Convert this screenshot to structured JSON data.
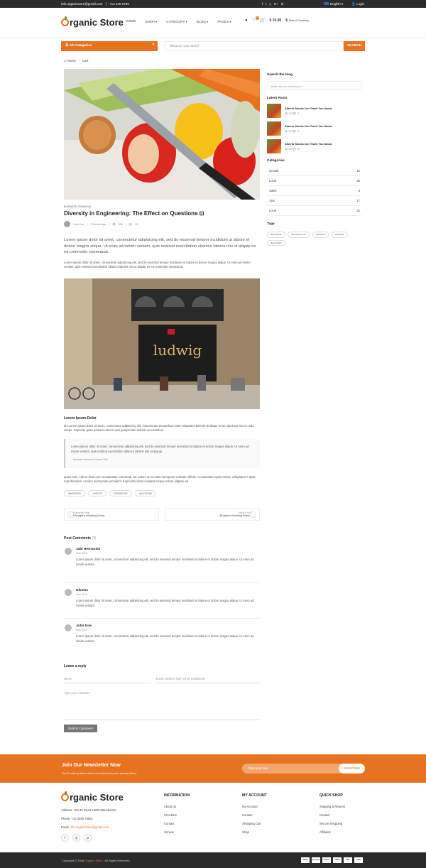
{
  "topbar": {
    "email": "info.organicstore@gmail.com",
    "sep": "|",
    "phone": "+12 345 6789",
    "social": [
      "f",
      "t",
      "y",
      "G+",
      "in"
    ],
    "language": "English ▾",
    "login": "Login"
  },
  "logo": {
    "rest": "rganic Store"
  },
  "nav": [
    "HOME",
    "SHOP",
    "CATEGORY",
    "BLOG",
    "PAGES"
  ],
  "cart": {
    "amount": "$ 15.00",
    "currency": "Select Currency",
    "badge": "2"
  },
  "catbar": {
    "label": "☰  All Categories",
    "arrow": "▾"
  },
  "search": {
    "placeholder": "What do you need?",
    "button": "SEARCH"
  },
  "breadcrumb": {
    "home": "Home",
    "sep": "-",
    "current": "Cart"
  },
  "post": {
    "category": "BUSINESS, FINANCIAL",
    "title": "Diversity in Engineering: The Effect on Questions",
    "author": "John Doe",
    "date": "2 Months Ago",
    "views": "300",
    "comments": "10",
    "lead": "Lorem ipsum dolor sit amet, consectetur adipisicing elit, sed do eiusmod tempor incididunt ut labore et dolore magna aliqua. Ut enim ad minim veniam, quis nostrud exercitation ullamco laboris nisi ut aliquip ex ea commodo consequat.",
    "para1": "Lorem ipsum dolor sit amet, consectetur adipisicing elit, sed do eiusmod tempor incididunt ut labore et dolore magna aliqua. Ut enim ad minim veniam, quis nostrud exercitation ullamco laboris nisi ut aliquip ex ea commodo consequat.",
    "storefront": "ludwig",
    "subhead": "Lorem Ipsum Dolor",
    "para2": "div Lorem ipsum dolor sit amet, consectetur adipisicing elit. Assumenda temporibus iusto voluptates deleniti similique rerum ducimus sint ex odio saepe. Sapiente quae pariatur ratione quis perspiciatis deleniti accusantium",
    "quote": "Lorem ipsum dolor sit amet, consectetur adipisicing elit, sed do eiusmod tempor incididunt ut labore et dolore magna aliqua. Ut enim ad minim veniam, quis nostrud exercitation ullamco laboris nisi ut aliquip.",
    "quote_by": "~ Someone famous in Source Title",
    "para3": "quasi nam. Libero dicta eum recusandae, commodi, ad, autem at ea iusto numquam veritatis, officiis. Accusantium optio minus, voluptatem? Quia reprehenderit, veniam quibusdam provident, fugit iusto ullam voluptas neque soluta adipisci ad.",
    "tags": [
      "#BUSINESS",
      "#TRICKS",
      "#TRAVELING",
      "#ECONOMY"
    ]
  },
  "pager": {
    "prev_label": "Previous Post",
    "prev_title": "I Bought a Wedding Dress.",
    "next_label": "Next Post",
    "next_title": "I Bought a Wedding Dress.",
    "prev_icon": "‹",
    "next_icon": "›"
  },
  "comments": {
    "title": "Post Comments",
    "count": "(3)",
    "items": [
      {
        "name": "Jabi Hernandiz",
        "date": "May 2016",
        "text": "Lorem ipsum dolor sit amet, consectetur adipisicing elit, sed do eiusmod tempor incididunt ut labore et dolore magna aliqua. Ut enim ad minim veniam."
      },
      {
        "name": "Nikolas",
        "date": "May 2016",
        "text": "Lorem ipsum dolor sit amet, consectetur adipisicing elit, sed do eiusmod tempor incididunt ut labore et dolore magna aliqua. Ut enim ad minim veniam."
      },
      {
        "name": "John Doe",
        "date": "May 2016",
        "text": "Lorem ipsum dolor sit amet, consectetur adipisicing elit, sed do eiusmod tempor incididunt ut labore et dolore magna aliqua. Ut enim ad minim veniam."
      }
    ]
  },
  "reply": {
    "title": "Leave a reply",
    "name": "Name",
    "email": "Email Address (will not be published)",
    "comment": "Type your comment",
    "submit": "Submit Comment"
  },
  "sidebar": {
    "search_title": "Search the blog",
    "search_placeholder": "What are you looking for?",
    "latest_title": "Latest Posts",
    "latest": [
      {
        "title": "Alberto Savoia Can Teach You About",
        "views": "300",
        "comments": "10"
      },
      {
        "title": "Alberto Savoia Can Teach You About",
        "views": "300",
        "comments": "10"
      },
      {
        "title": "Alberto Savoia Can Teach You About",
        "views": "300",
        "comments": "10"
      }
    ],
    "categories_title": "Categories",
    "categories": [
      {
        "name": "Growth",
        "count": "12"
      },
      {
        "name": "Local",
        "count": "26"
      },
      {
        "name": "Sales",
        "count": "8"
      },
      {
        "name": "Tips",
        "count": "17"
      },
      {
        "name": "Local",
        "count": "22"
      }
    ],
    "tags_title": "Tags",
    "tags": [
      "#BUSINESS",
      "#TECHNOLOGY",
      "#FASHION",
      "#SPORTS",
      "#ECONOMY"
    ]
  },
  "newsletter": {
    "title": "Join Our Newsletter Now",
    "sub": "Get E-mail updates about our latest shop and special offers.",
    "placeholder": "Enter your mail",
    "button": "SUBSCRIBE"
  },
  "footer": {
    "address": "Address: 123-45 Road 11378 Manchester",
    "phone": "Phone: +12 3456 78901",
    "email_label": "Email:",
    "email": "info.organicstore@gmail.com",
    "social": [
      "f",
      "◎",
      "p"
    ],
    "info_title": "INFORMATION",
    "info": [
      "About Us",
      "Checkout",
      "Contact",
      "Servius"
    ],
    "account_title": "MY ACCOUNT",
    "account": [
      "My Account",
      "Contact",
      "Shopping Cart",
      "Shop"
    ],
    "quick_title": "QUICK SHOP",
    "quick": [
      "Shipping & Returns",
      "Contact",
      "Secure Shopping",
      "Affiliates"
    ]
  },
  "bottom": {
    "copy": "Copyright © 2016",
    "brand": "Organic Store",
    "rights": " - All Rights Reserved.",
    "payments": [
      "Skrill",
      "discover",
      "PayPal",
      "AMEX",
      "MC",
      "VISA"
    ]
  },
  "colors": {
    "accent": "#e8731f",
    "dark": "#2b2b2b"
  }
}
